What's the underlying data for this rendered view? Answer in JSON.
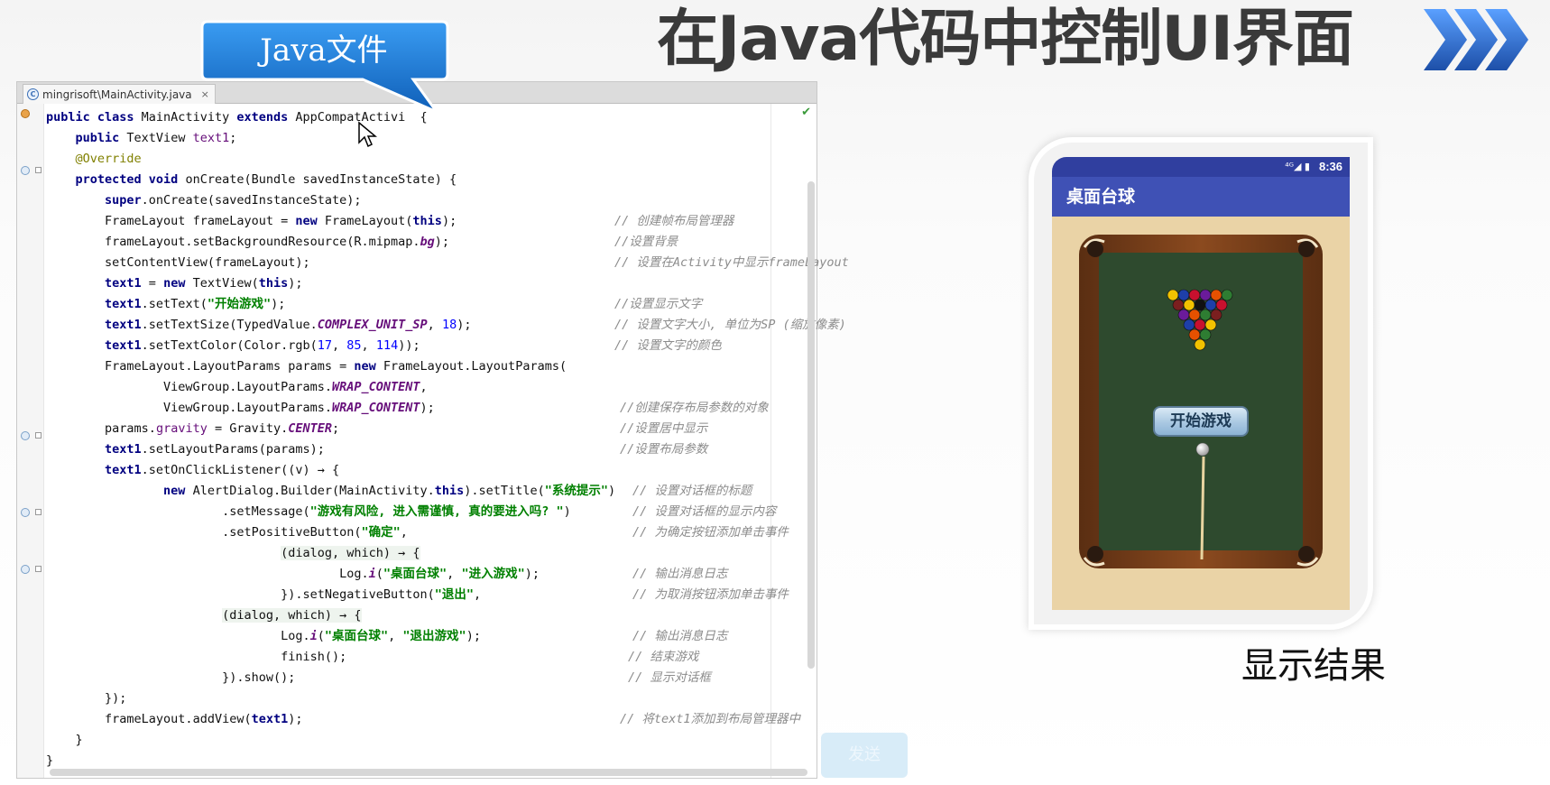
{
  "slide": {
    "title": "在Java代码中控制UI界面",
    "callout": "Java文件",
    "result_label": "显示结果",
    "send_button": "发送"
  },
  "editor": {
    "tab_label": "mingrisoft\\MainActivity.java",
    "tab_icon": "C",
    "tab_close": "×",
    "code": {
      "l1a": "public class ",
      "l1b": "MainActivity ",
      "l1c": "extends ",
      "l1d": "AppCompatActivi",
      "l1e": "  {",
      "l2a": "public ",
      "l2b": "TextView ",
      "l2c": "text1",
      "l3": "@Override",
      "l4a": "protected void ",
      "l4b": "onCreate(Bundle savedInstanceState) {",
      "l5a": "super",
      "l5b": ".onCreate(savedInstanceState);",
      "l6a": "FrameLayout frameLayout = ",
      "l6b": "new ",
      "l6c": "FrameLayout(",
      "l6d": "this",
      "l6e": ");",
      "l6cmt": "// 创建帧布局管理器",
      "l7a": "frameLayout.setBackgroundResource(R.mipmap.",
      "l7b": "bg",
      "l7c": ");",
      "l7cmt": "//设置背景",
      "l8a": "setContentView(frameLayout);",
      "l8cmt": "// 设置在Activity中显示frameLayout",
      "l9a": "text1",
      "l9b": " = ",
      "l9c": "new ",
      "l9d": "TextView(",
      "l9e": "this",
      "l9f": ");",
      "l10a": "text1",
      "l10b": ".setText(",
      "l10c": "\"开始游戏\"",
      "l10d": ");",
      "l10cmt": "//设置显示文字",
      "l11a": "text1",
      "l11b": ".setTextSize(TypedValue.",
      "l11c": "COMPLEX_UNIT_SP",
      "l11d": ", ",
      "l11e": "18",
      "l11f": ");",
      "l11cmt": "// 设置文字大小, 单位为SP (缩放像素)",
      "l12a": "text1",
      "l12b": ".setTextColor(Color.rgb(",
      "l12c": "17",
      "l12d": ", ",
      "l12e": "85",
      "l12f": ", ",
      "l12g": "114",
      "l12h": "));",
      "l12cmt": "// 设置文字的颜色",
      "l13a": "FrameLayout.LayoutParams params = ",
      "l13b": "new ",
      "l13c": "FrameLayout.LayoutParams(",
      "l14a": "ViewGroup.LayoutParams.",
      "l14b": "WRAP_CONTENT",
      "l14c": ",",
      "l15a": "ViewGroup.LayoutParams.",
      "l15b": "WRAP_CONTENT",
      "l15c": ");",
      "l15cmt": "//创建保存布局参数的对象",
      "l16a": "params.",
      "l16b": "gravity",
      "l16c": " = Gravity.",
      "l16d": "CENTER",
      "l16e": ";",
      "l16cmt": "//设置居中显示",
      "l17a": "text1",
      "l17b": ".setLayoutParams(params);",
      "l17cmt": "//设置布局参数",
      "l18a": "text1",
      "l18b": ".setOnClickListener((v) → {",
      "l19a": "new ",
      "l19b": "AlertDialog.Builder(MainActivity.",
      "l19c": "this",
      "l19d": ").setTitle(",
      "l19e": "\"系统提示\"",
      "l19f": ")",
      "l19cmt": "// 设置对话框的标题",
      "l20a": ".setMessage(",
      "l20b": "\"游戏有风险, 进入需谨慎, 真的要进入吗? \"",
      "l20c": ")",
      "l20cmt": "// 设置对话框的显示内容",
      "l21a": ".setPositiveButton(",
      "l21b": "\"确定\"",
      "l21c": ",",
      "l21cmt": "// 为确定按钮添加单击事件",
      "l22a": "(dialog, which) → {",
      "l23a": "Log.",
      "l23b": "i",
      "l23c": "(",
      "l23d": "\"桌面台球\"",
      "l23e": ", ",
      "l23f": "\"进入游戏\"",
      "l23g": ");",
      "l23cmt": "// 输出消息日志",
      "l24a": "}).setNegativeButton(",
      "l24b": "\"退出\"",
      "l24c": ",",
      "l24cmt": "// 为取消按钮添加单击事件",
      "l25a": "(dialog, which) → {",
      "l26a": "Log.",
      "l26b": "i",
      "l26c": "(",
      "l26d": "\"桌面台球\"",
      "l26e": ", ",
      "l26f": "\"退出游戏\"",
      "l26g": ");",
      "l26cmt": "// 输出消息日志",
      "l27a": "finish();",
      "l27cmt": "// 结束游戏",
      "l28a": "}).show();",
      "l28cmt": "// 显示对话框",
      "l29a": "});",
      "l30a": "frameLayout.addView(",
      "l30b": "text1",
      "l30c": ");",
      "l30cmt": "// 将text1添加到布局管理器中",
      "l31a": "}",
      "l32a": "}"
    }
  },
  "phone": {
    "status_icons": "⁴ᴳ◢ ▮",
    "time": "8:36",
    "app_title": "桌面台球",
    "start_button": "开始游戏"
  },
  "colors": {
    "title": "#3a3a3a",
    "callout": "#1e78d6",
    "chevrons": "#1d4fa8",
    "keyword": "#000080",
    "string": "#008000",
    "comment": "#8c8c8c",
    "appbar": "#3f51b5",
    "statusbar": "#303f9f",
    "felt": "#2e4a2e"
  }
}
